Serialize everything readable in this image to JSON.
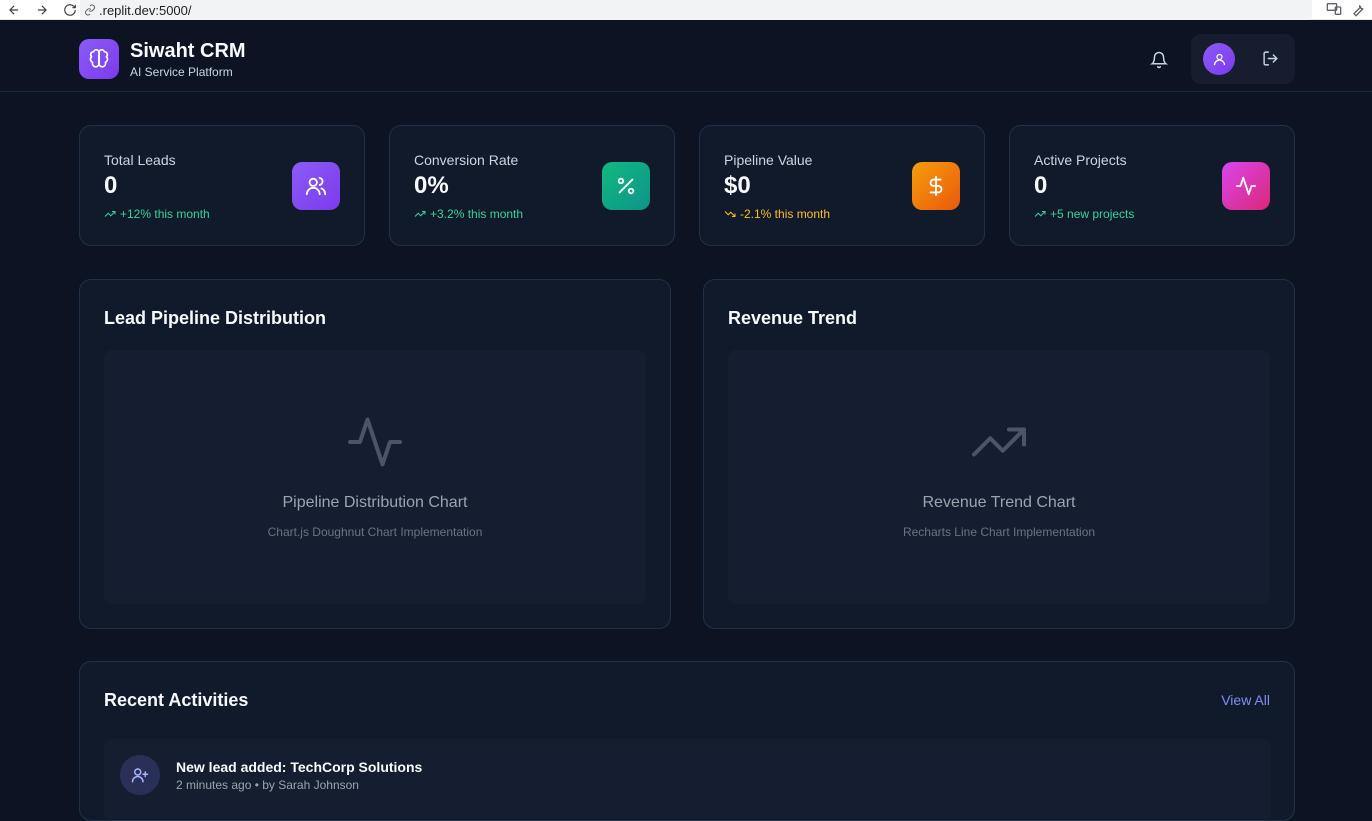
{
  "browser": {
    "url": ".replit.dev:5000/"
  },
  "header": {
    "title": "Siwaht CRM",
    "subtitle": "AI Service Platform",
    "logo_icon": "brain-icon",
    "notification_icon": "bell-icon",
    "user_icon": "user-icon",
    "logout_icon": "logout-icon"
  },
  "stats": [
    {
      "title": "Total Leads",
      "value": "0",
      "trend": "+12% this month",
      "direction": "up",
      "icon": "users-icon",
      "color": "#8b5cf6"
    },
    {
      "title": "Conversion Rate",
      "value": "0%",
      "trend": "+3.2% this month",
      "direction": "up",
      "icon": "percent-icon",
      "color": "#10b981"
    },
    {
      "title": "Pipeline Value",
      "value": "$0",
      "trend": "-2.1% this month",
      "direction": "down",
      "icon": "dollar-icon",
      "color": "#f97316"
    },
    {
      "title": "Active Projects",
      "value": "0",
      "trend": "+5 new projects",
      "direction": "up",
      "icon": "activity-icon",
      "color": "#d946ef"
    }
  ],
  "charts": [
    {
      "title": "Lead Pipeline Distribution",
      "placeholder_title": "Pipeline Distribution Chart",
      "placeholder_sub": "Chart.js Doughnut Chart Implementation",
      "icon": "activity-icon"
    },
    {
      "title": "Revenue Trend",
      "placeholder_title": "Revenue Trend Chart",
      "placeholder_sub": "Recharts Line Chart Implementation",
      "icon": "trending-up-icon"
    }
  ],
  "activities": {
    "title": "Recent Activities",
    "view_all": "View All",
    "items": [
      {
        "text": "New lead added: TechCorp Solutions",
        "meta": "2 minutes ago • by Sarah Johnson",
        "icon": "user-plus-icon"
      }
    ]
  }
}
